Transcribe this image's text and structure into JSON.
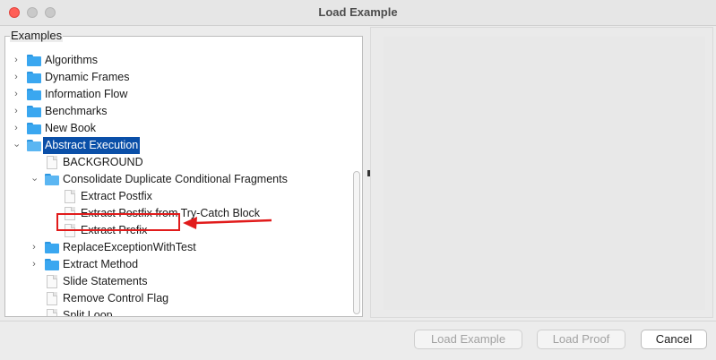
{
  "window": {
    "title": "Load Example"
  },
  "examples_panel": {
    "label": "Examples",
    "tree": [
      {
        "label": "Algorithms"
      },
      {
        "label": "Dynamic Frames"
      },
      {
        "label": "Information Flow"
      },
      {
        "label": "Benchmarks"
      },
      {
        "label": "New Book"
      },
      {
        "label": "Abstract Execution",
        "selected": true
      },
      {
        "label": "BACKGROUND"
      },
      {
        "label": "Consolidate Duplicate Conditional Fragments"
      },
      {
        "label": "Extract Postfix"
      },
      {
        "label": "Extract Postfix from Try-Catch Block"
      },
      {
        "label": "Extract Prefix",
        "annotated": true
      },
      {
        "label": "ReplaceExceptionWithTest"
      },
      {
        "label": "Extract Method"
      },
      {
        "label": "Slide Statements"
      },
      {
        "label": "Remove Control Flag"
      },
      {
        "label": "Split Loop"
      }
    ]
  },
  "buttons": {
    "load_example": "Load Example",
    "load_proof": "Load Proof",
    "cancel": "Cancel"
  },
  "colors": {
    "selection": "#0a4fa8",
    "annotation": "#e11b1b",
    "folder": "#3aa7f0"
  }
}
